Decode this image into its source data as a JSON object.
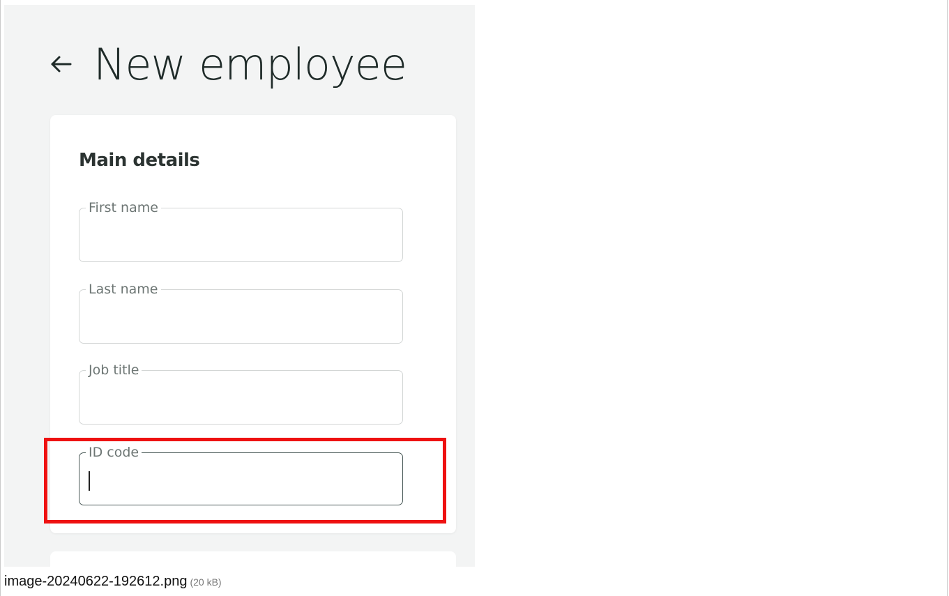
{
  "page": {
    "title": "New employee",
    "back_icon": "arrow-left-icon"
  },
  "main_details": {
    "heading": "Main details",
    "fields": [
      {
        "label": "First name",
        "value": ""
      },
      {
        "label": "Last name",
        "value": ""
      },
      {
        "label": "Job title",
        "value": ""
      },
      {
        "label": "ID code",
        "value": ""
      }
    ]
  },
  "highlight": {
    "color": "#ee1111",
    "target": "ID code"
  },
  "attachment": {
    "filename": "image-20240622-192612.png",
    "size": "(20 kB)"
  }
}
